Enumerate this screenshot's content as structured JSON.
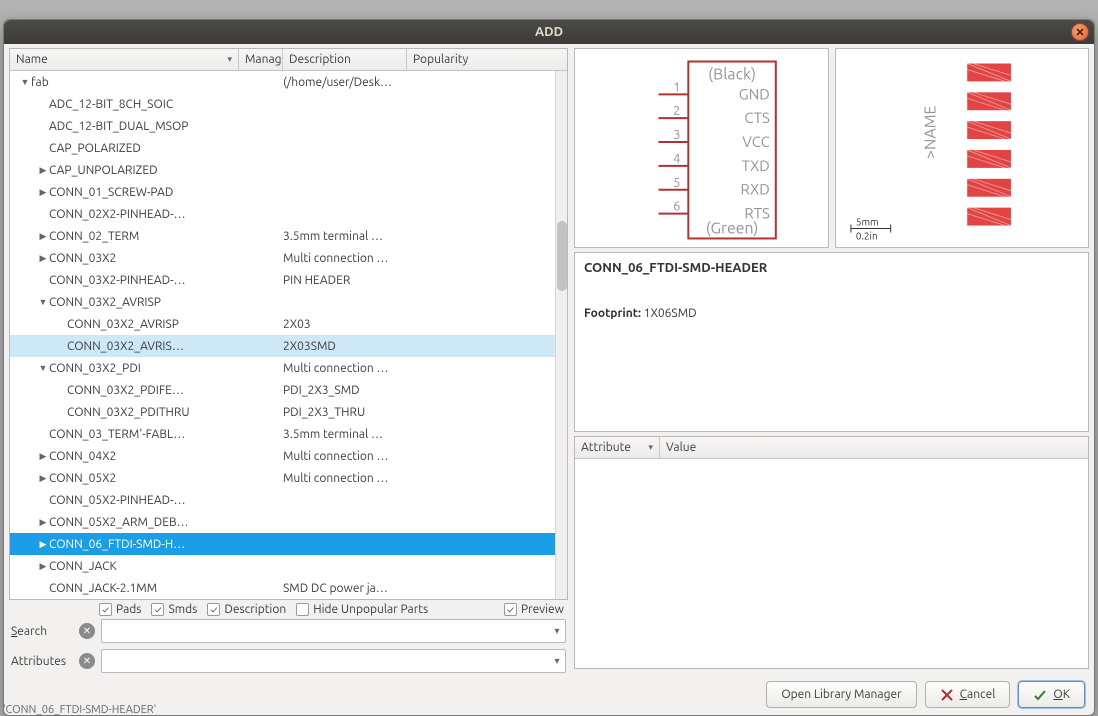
{
  "window": {
    "title": "ADD"
  },
  "columns": {
    "name": "Name",
    "managed": "Managed",
    "description": "Description",
    "popularity": "Popularity",
    "managed_short": "Managed"
  },
  "col_widths": {
    "name": 229,
    "managed": 44,
    "description": 124,
    "popularity": 148
  },
  "tree": [
    {
      "level": 0,
      "expand": "open",
      "name": "fab",
      "desc": "(/home/user/Desk…"
    },
    {
      "level": 1,
      "expand": "none",
      "name": "ADC_12-BIT_8CH_SOIC",
      "desc": ""
    },
    {
      "level": 1,
      "expand": "none",
      "name": "ADC_12-BIT_DUAL_MSOP",
      "desc": ""
    },
    {
      "level": 1,
      "expand": "none",
      "name": "CAP_POLARIZED",
      "desc": ""
    },
    {
      "level": 1,
      "expand": "closed",
      "name": "CAP_UNPOLARIZED",
      "desc": ""
    },
    {
      "level": 1,
      "expand": "closed",
      "name": "CONN_01_SCREW-PAD",
      "desc": ""
    },
    {
      "level": 1,
      "expand": "none",
      "name": "CONN_02X2-PINHEAD-…",
      "desc": ""
    },
    {
      "level": 1,
      "expand": "closed",
      "name": "CONN_02_TERM",
      "desc": "3.5mm terminal …"
    },
    {
      "level": 1,
      "expand": "closed",
      "name": "CONN_03X2",
      "desc": "Multi connection …"
    },
    {
      "level": 1,
      "expand": "none",
      "name": "CONN_03X2-PINHEAD-…",
      "desc": "PIN HEADER"
    },
    {
      "level": 1,
      "expand": "open",
      "name": "CONN_03X2_AVRISP",
      "desc": ""
    },
    {
      "level": 2,
      "expand": "none",
      "name": "CONN_03X2_AVRISP",
      "desc": "2X03"
    },
    {
      "level": 2,
      "expand": "none",
      "name": "CONN_03X2_AVRIS…",
      "desc": "2X03SMD",
      "selLight": true
    },
    {
      "level": 1,
      "expand": "open",
      "name": "CONN_03X2_PDI",
      "desc": "Multi connection …"
    },
    {
      "level": 2,
      "expand": "none",
      "name": "CONN_03X2_PDIFE…",
      "desc": "PDI_2X3_SMD"
    },
    {
      "level": 2,
      "expand": "none",
      "name": "CONN_03X2_PDITHRU",
      "desc": "PDI_2X3_THRU"
    },
    {
      "level": 1,
      "expand": "none",
      "name": "CONN_03_TERM'-FABL…",
      "desc": "3.5mm terminal …"
    },
    {
      "level": 1,
      "expand": "closed",
      "name": "CONN_04X2",
      "desc": "Multi connection …"
    },
    {
      "level": 1,
      "expand": "closed",
      "name": "CONN_05X2",
      "desc": "Multi connection …"
    },
    {
      "level": 1,
      "expand": "none",
      "name": "CONN_05X2-PINHEAD-…",
      "desc": ""
    },
    {
      "level": 1,
      "expand": "closed",
      "name": "CONN_05X2_ARM_DEB…",
      "desc": ""
    },
    {
      "level": 1,
      "expand": "closed",
      "name": "CONN_06_FTDI-SMD-H…",
      "desc": "",
      "selected": true
    },
    {
      "level": 1,
      "expand": "closed",
      "name": "CONN_JACK",
      "desc": ""
    },
    {
      "level": 1,
      "expand": "none",
      "name": "CONN_JACK-2.1MM",
      "desc": "SMD DC power ja…"
    }
  ],
  "filters": {
    "pads": {
      "checked": true,
      "label": "Pads"
    },
    "smds": {
      "checked": true,
      "label": "Smds"
    },
    "description": {
      "checked": true,
      "label": "Description"
    },
    "hide_unpopular": {
      "checked": false,
      "label": "Hide Unpopular Parts"
    },
    "preview": {
      "checked": true,
      "label": "Preview"
    }
  },
  "search": {
    "label": "Search",
    "value": "",
    "attributes_label": "Attributes",
    "attributes_value": ""
  },
  "info": {
    "title": "CONN_06_FTDI-SMD-HEADER",
    "footprint_label": "Footprint:",
    "footprint_value": "1X06SMD"
  },
  "attr_table": {
    "col_attribute": "Attribute",
    "col_value": "Value"
  },
  "buttons": {
    "open_library": "Open Library Manager",
    "cancel": "Cancel",
    "ok": "OK"
  },
  "schematic": {
    "top_label": "(Black)",
    "pins": [
      "GND",
      "CTS",
      "VCC",
      "TXD",
      "RXD",
      "RTS"
    ],
    "pin_nums": [
      "1",
      "2",
      "3",
      "4",
      "5",
      "6"
    ],
    "bottom_label": "(Green)"
  },
  "footprint_preview": {
    "name_label": ">NAME",
    "scale_mm": "5mm",
    "scale_in": "0.2in"
  },
  "status_text": "'CONN_06_FTDI-SMD-HEADER'"
}
